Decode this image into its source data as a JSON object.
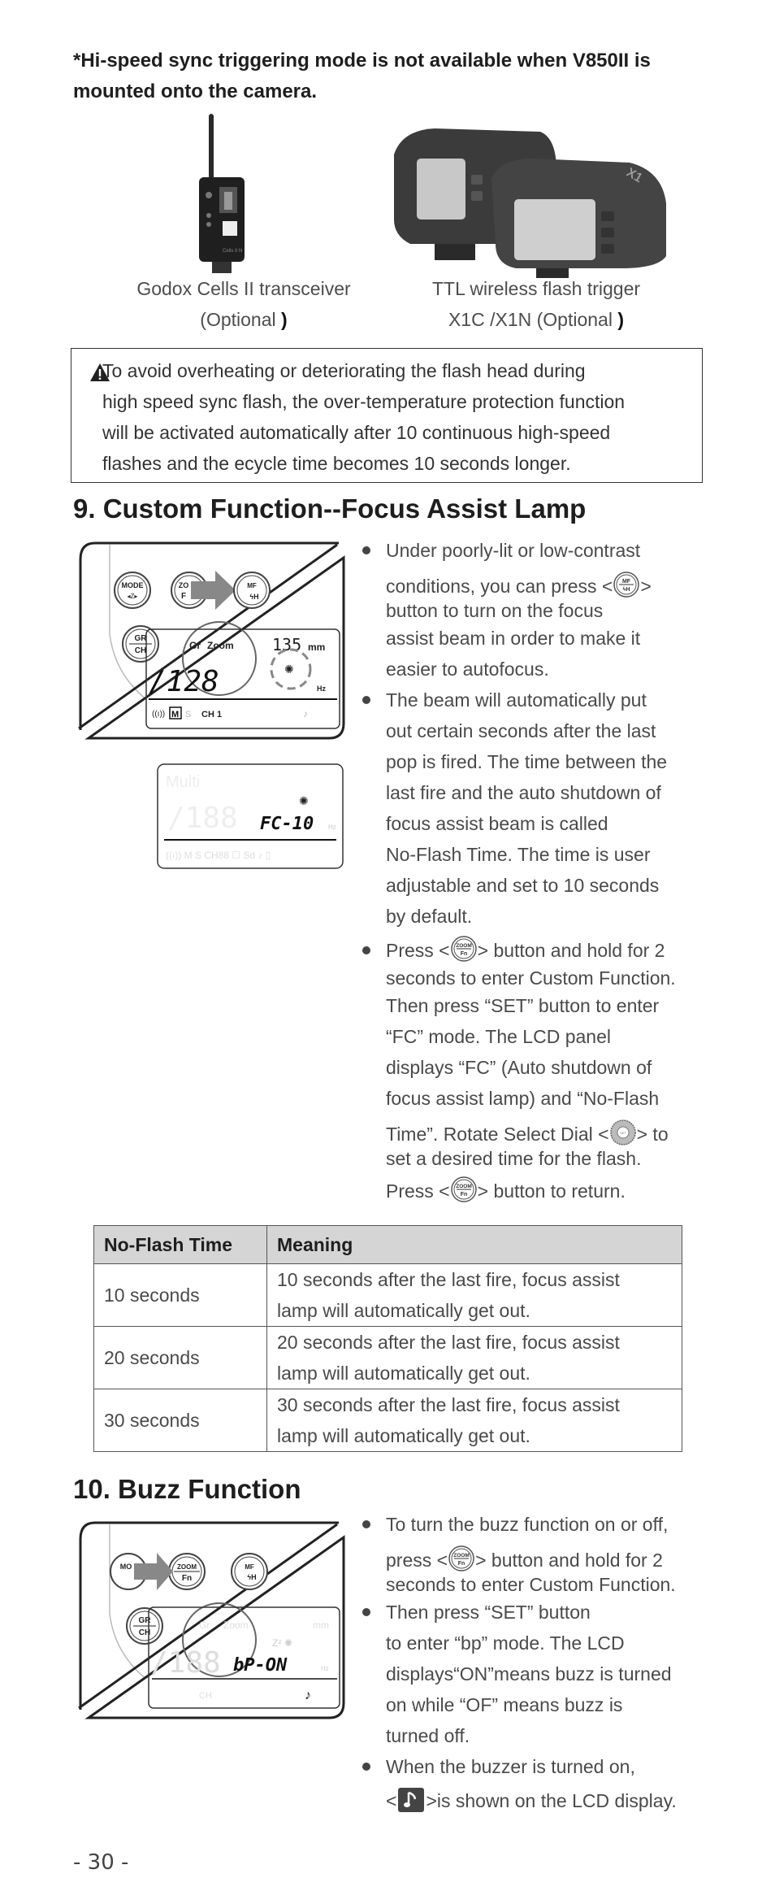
{
  "note": {
    "text": "*Hi-speed sync triggering mode is not available when V850II is mounted onto the camera."
  },
  "products": [
    {
      "name": "Godox Cells II transceiver",
      "optional_label": "(Optional",
      "close": ")",
      "device_label": "Cells II N"
    },
    {
      "name": "TTL wireless flash trigger",
      "optional_label": "X1C /X1N  (Optional",
      "close": ")",
      "device_label": "X1"
    }
  ],
  "warning": {
    "icon": "warning-triangle-icon",
    "lines": [
      "To avoid overheating or deteriorating the flash head during",
      "high speed sync flash, the over-temperature protection function",
      "will be activated automatically after 10 continuous high-speed",
      "flashes and the ecycle time becomes 10 seconds longer."
    ]
  },
  "section9": {
    "title": "9. Custom Function--Focus Assist Lamp",
    "diagram": {
      "buttons": {
        "mode_top": "MODE",
        "zoom_top": "ZO",
        "zoom_bottom": "F",
        "mf_top": "MF",
        "mf_bottom": "H",
        "gr": "GR",
        "ch": "CH"
      },
      "lcd": {
        "gr": "Gr",
        "zoom": "Zoom",
        "zoom_value": "135",
        "mm": "mm",
        "power": "/128",
        "hz": "Hz",
        "ch_label": "CH",
        "ch_value": "1",
        "mode": "M",
        "s": "S"
      }
    },
    "lcd2": {
      "multi": "Multi",
      "readout": "FC-10",
      "hz": "Hz"
    },
    "bullets": [
      {
        "lines": [
          "Under poorly-lit or low-contrast",
          "conditions, you can press <",
          "> ",
          "button to turn on the focus",
          "assist beam in order to make it",
          "easier to autofocus."
        ],
        "icon": "mf-button-icon",
        "icon_top": "MF",
        "icon_bottom": "H"
      },
      {
        "lines": [
          "The beam will automatically put",
          "out certain seconds after the last",
          "pop is fired. The time between the",
          "last fire and the auto shutdown of",
          "focus assist beam is called",
          "No-Flash Time. The time is user",
          "adjustable and set to 10 seconds",
          "by default."
        ]
      },
      {
        "lines": [
          "Press <",
          "> button and hold for 2",
          "seconds to enter Custom Function.",
          "Then press “SET” button to enter",
          "“FC” mode. The LCD panel",
          "displays “FC” (Auto shutdown of",
          "focus assist lamp) and “No-Flash",
          "Time”. Rotate Select Dial <",
          "> to",
          "set a desired time for the flash.",
          "Press <",
          "> button to return."
        ],
        "zoom_icon_top": "ZOOM",
        "zoom_icon_bottom": "Fn",
        "dial_icon_label": "SET"
      }
    ],
    "table": {
      "headers": [
        "No-Flash Time",
        "Meaning"
      ],
      "rows": [
        {
          "time": "10 seconds",
          "meaning_1": "10 seconds after the last fire, focus assist",
          "meaning_2": "lamp will automatically get out."
        },
        {
          "time": "20 seconds",
          "meaning_1": "20 seconds after the last fire, focus assist",
          "meaning_2": "lamp will automatically get out."
        },
        {
          "time": "30 seconds",
          "meaning_1": "30 seconds after the last fire, focus assist",
          "meaning_2": "lamp will automatically get out."
        }
      ]
    }
  },
  "section10": {
    "title": "10. Buzz Function",
    "diagram": {
      "buttons": {
        "mode_top": "MO",
        "zoom_top": "ZOOM",
        "zoom_bottom": "Fn",
        "mf_top": "MF",
        "mf_bottom": "H",
        "gr": "GR",
        "ch": "CH"
      },
      "lcd": {
        "gr": "Gr",
        "zoom": "Zoom",
        "mm": "mm",
        "readout": "bP-ON",
        "hz": "Hz",
        "ch_label": "CH"
      }
    },
    "bullets": [
      {
        "lines": [
          "To turn the buzz function on or off,",
          "press <",
          "> button and hold for 2",
          "seconds to enter Custom Function."
        ]
      },
      {
        "lines": [
          "Then press “SET” button",
          "to enter “bp” mode. The LCD",
          "displays“ON”means buzz is turned",
          "on while “OF” means buzz is",
          "turned off."
        ]
      },
      {
        "lines": [
          "When the buzzer is turned on,",
          "<",
          ">is shown on the LCD display."
        ],
        "icon": "music-note-icon"
      }
    ]
  },
  "page_number": "- 30 -"
}
